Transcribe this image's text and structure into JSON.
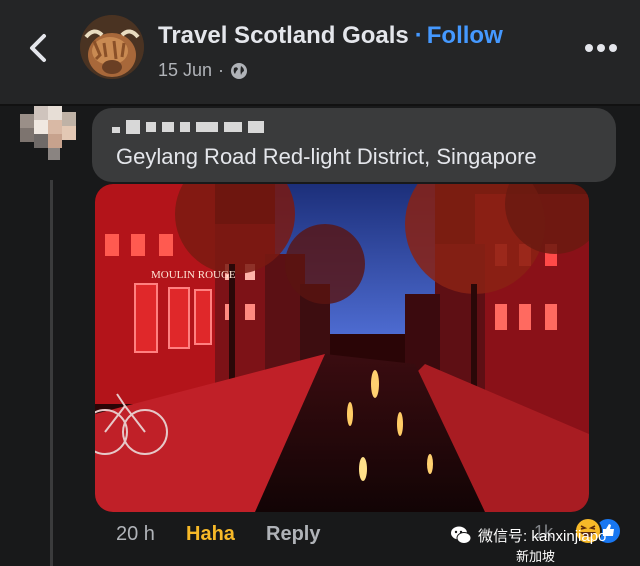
{
  "header": {
    "page_name": "Travel Scotland Goals",
    "separator": "·",
    "follow_label": "Follow",
    "post_date": "15 Jun",
    "meta_separator": "·"
  },
  "comment": {
    "text": "Geylang Road Red-light District, Singapore",
    "photo": {
      "sign_text": "MOULIN ROUGE"
    }
  },
  "comment_actions": {
    "time": "20 h",
    "reaction_label": "Haha",
    "reply_label": "Reply",
    "reaction_count": "1k"
  },
  "watermark": {
    "wechat_text": "微信号: kanxinjiapo",
    "bottom_text": "新加坡"
  },
  "colors": {
    "background": "#18191a",
    "header": "#242526",
    "bubble": "#3a3b3c",
    "follow_blue": "#4599ff",
    "haha_yellow": "#f7b928",
    "muted_text": "#b0b3b8"
  }
}
